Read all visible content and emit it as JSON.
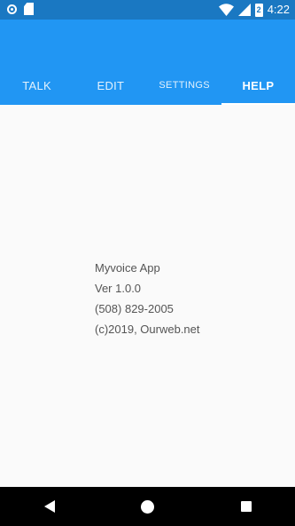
{
  "status_bar": {
    "time": "4:22",
    "battery_label": "2",
    "icons": [
      "sync-icon",
      "sd-card-icon",
      "wifi-icon",
      "signal-icon",
      "battery-icon"
    ]
  },
  "tabs": [
    {
      "label": "TALK",
      "active": false
    },
    {
      "label": "EDIT",
      "active": false
    },
    {
      "label": "SETTINGS",
      "active": false
    },
    {
      "label": "HELP",
      "active": true
    }
  ],
  "help": {
    "app_name": "Myvoice App",
    "version": "Ver 1.0.0",
    "phone": "(508) 829-2005",
    "copyright": "(c)2019, Ourweb.net"
  },
  "nav_bar": {
    "icons": [
      "back-icon",
      "home-icon",
      "recents-icon"
    ]
  },
  "colors": {
    "status_bar": "#1a78c2",
    "app_bar": "#2196f3",
    "background": "#fafafa",
    "nav_bar": "#000000"
  }
}
